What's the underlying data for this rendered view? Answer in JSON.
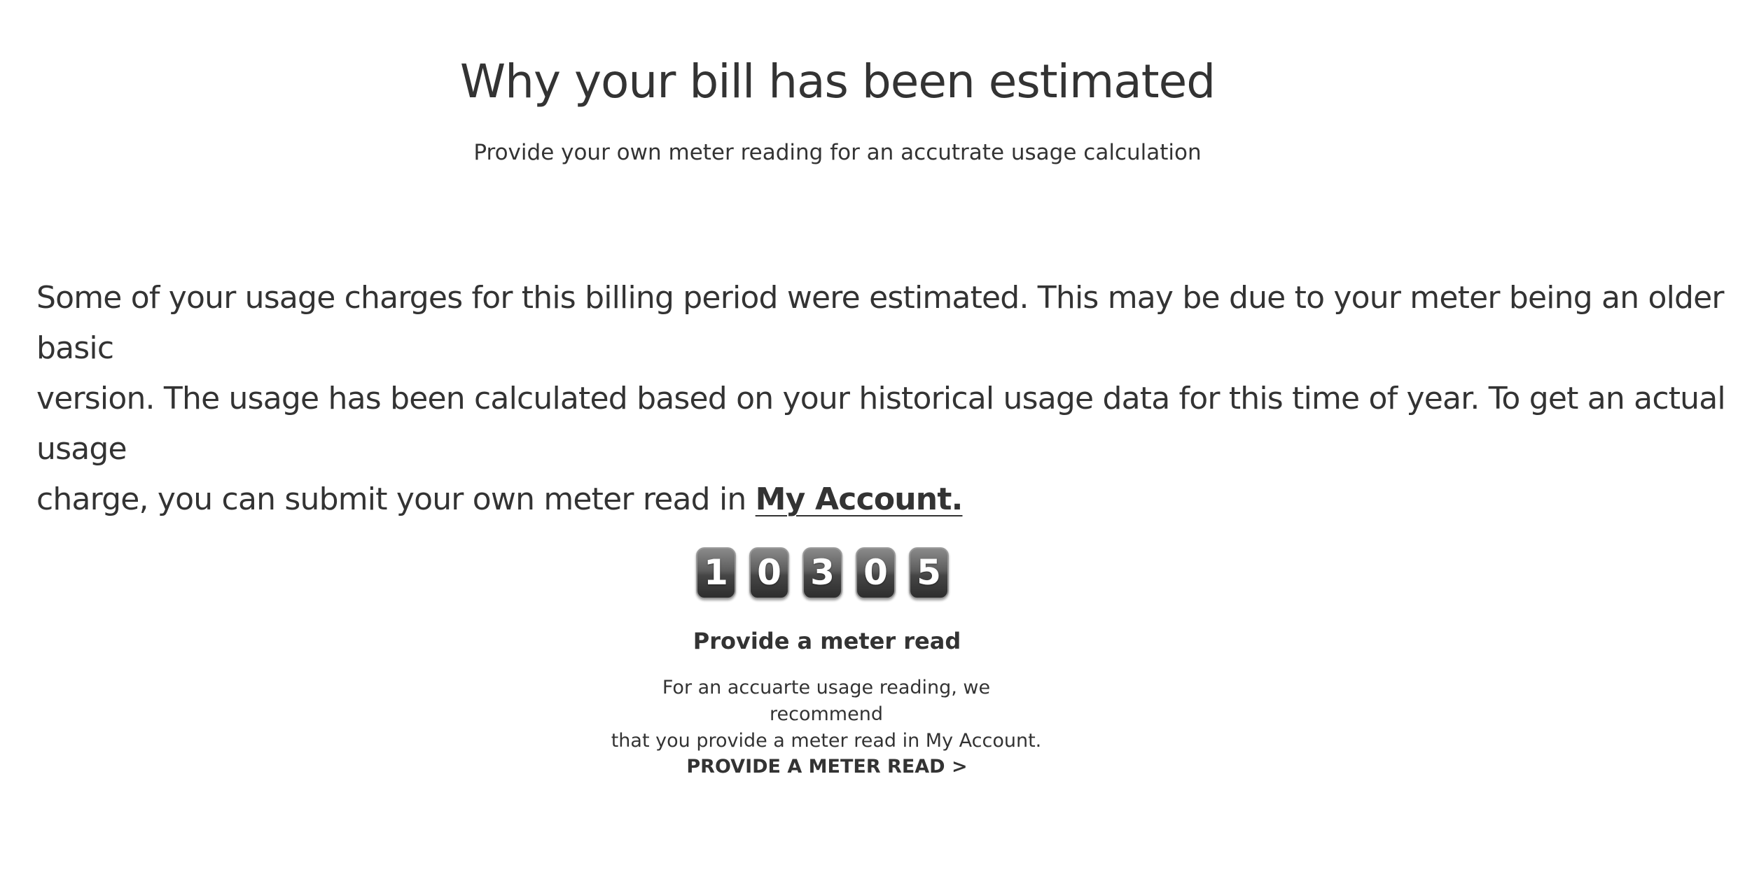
{
  "header": {
    "title": "Why your bill has been estimated",
    "subtitle": "Provide your own meter reading for an accutrate usage calculation"
  },
  "explanation": {
    "line1": " Some of your usage charges for this billing period were estimated. This may be due to your meter being an older basic",
    "line2": "version.  The usage has been calculated based on your historical usage data for this time of year. To get an actual usage",
    "line3": "charge, you can submit your own meter read in ",
    "link_label": "My Account."
  },
  "meter": {
    "digits": [
      "1",
      "0",
      "3",
      "0",
      "5"
    ],
    "title": "Provide a meter read",
    "description_line1": "For an accuarte usage reading, we recommend",
    "description_line2": "that you provide a meter read in My Account.",
    "cta_label": "PROVIDE A METER READ >"
  }
}
